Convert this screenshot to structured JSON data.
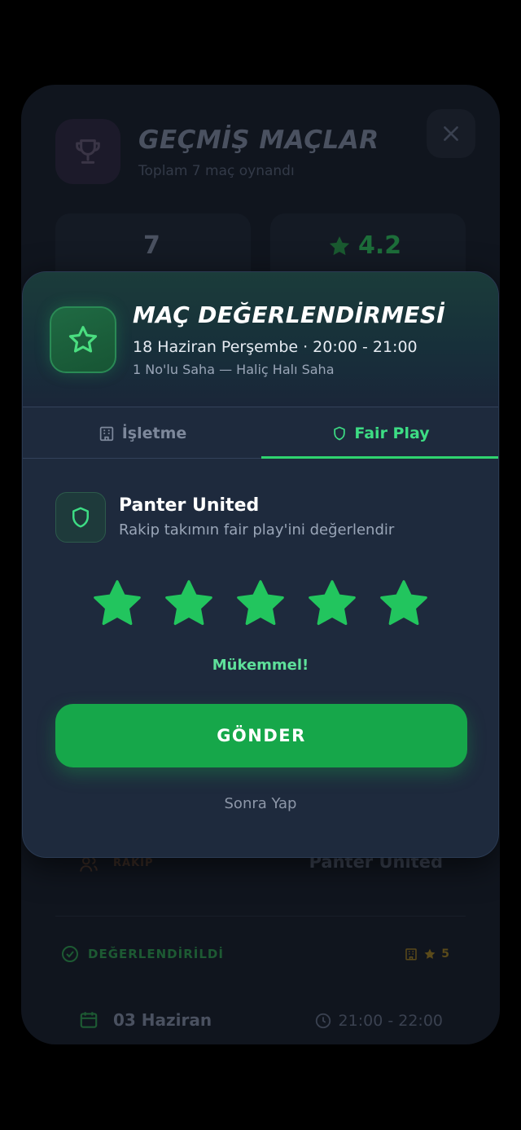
{
  "background": {
    "title": "GEÇMİŞ MAÇLAR",
    "subtitle": "Toplam 7 maç oynandı",
    "stat_matches": "7",
    "stat_rating": "4.2",
    "rival_label": "RAKİP",
    "rival_team": "Panter United",
    "rated_label": "DEĞERLENDİRİLDİ",
    "rated_score": "5",
    "date": "03 Haziran",
    "time": "21:00 - 22:00"
  },
  "modal": {
    "title": "MAÇ DEĞERLENDİRMESİ",
    "date_time": "18 Haziran Perşembe · 20:00 - 21:00",
    "venue": "1 No'lu Saha — Haliç Halı Saha",
    "tabs": [
      {
        "label": "İşletme",
        "active": false
      },
      {
        "label": "Fair Play",
        "active": true
      }
    ],
    "team_name": "Panter United",
    "team_prompt": "Rakip takımın fair play'ini değerlendir",
    "rating": 5,
    "rating_max": 5,
    "rating_label": "Mükemmel!",
    "submit_label": "GÖNDER",
    "later_label": "Sonra Yap"
  },
  "colors": {
    "accent": "#16a74a",
    "star": "#22c55e",
    "active_tab": "#3ddc84"
  }
}
